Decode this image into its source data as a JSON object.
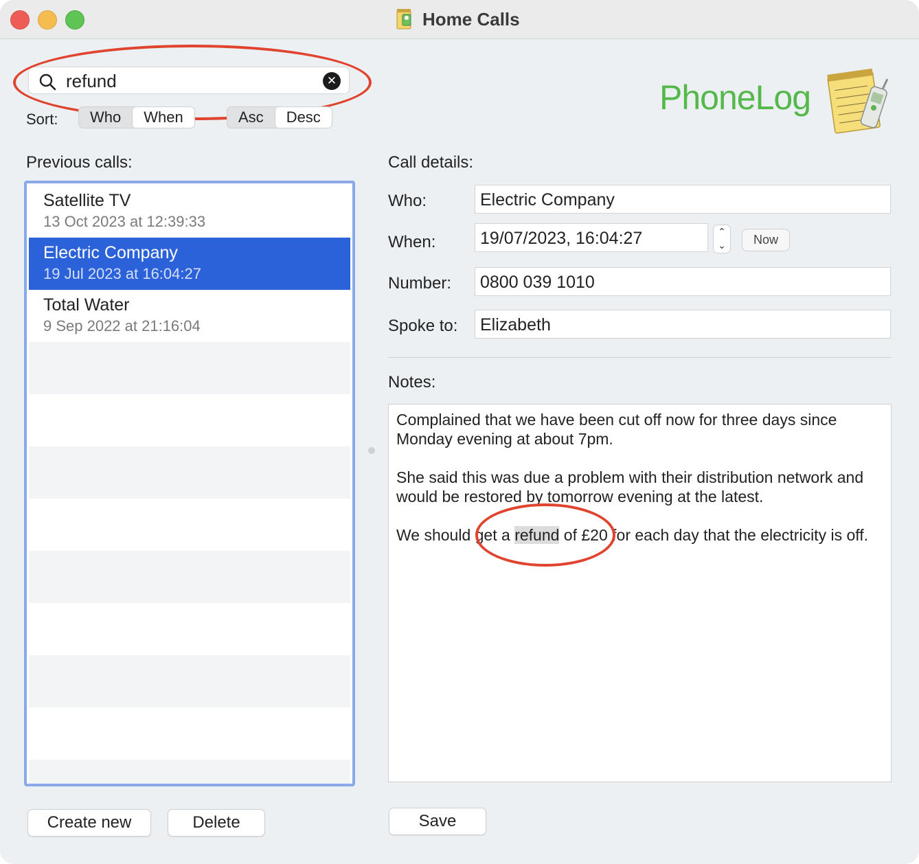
{
  "window": {
    "title": "Home Calls",
    "app_icon": "phonelog-app-icon"
  },
  "search": {
    "value": "refund",
    "icon": "magnifier-icon",
    "clear_icon": "clear-circle-x-icon"
  },
  "sort": {
    "label": "Sort:",
    "field_options": [
      "Who",
      "When"
    ],
    "field_selected": "When",
    "order_options": [
      "Asc",
      "Desc"
    ],
    "order_selected": "Desc"
  },
  "brand": {
    "logo_text": "PhoneLog",
    "logo_color": "#54b84a"
  },
  "list": {
    "heading": "Previous calls:",
    "items": [
      {
        "title": "Satellite TV",
        "subtitle": "13 Oct 2023 at 12:39:33",
        "selected": false
      },
      {
        "title": "Electric Company",
        "subtitle": "19 Jul 2023 at 16:04:27",
        "selected": true
      },
      {
        "title": "Total Water",
        "subtitle": "9 Sep 2022 at 21:16:04",
        "selected": false
      }
    ],
    "selection_color": "#2b62d9"
  },
  "buttons": {
    "create_new": "Create new",
    "delete": "Delete",
    "save": "Save",
    "now": "Now"
  },
  "details": {
    "heading": "Call details:",
    "who_label": "Who:",
    "who_value": "Electric Company",
    "when_label": "When:",
    "when_value": "19/07/2023, 16:04:27",
    "number_label": "Number:",
    "number_value": "0800 039 1010",
    "spoke_label": "Spoke to:",
    "spoke_value": "Elizabeth",
    "notes_label": "Notes:",
    "notes": {
      "p1": "Complained that we have been cut off now for three days since Monday evening at about 7pm.",
      "p2": "She said this was due a problem with their distribution network and would be restored by tomorrow evening at the latest.",
      "p3_before": "We should get a ",
      "p3_match": "refund",
      "p3_after": " of £20 for each day that the electricity is off."
    }
  },
  "annotation_color": "#e0442f"
}
